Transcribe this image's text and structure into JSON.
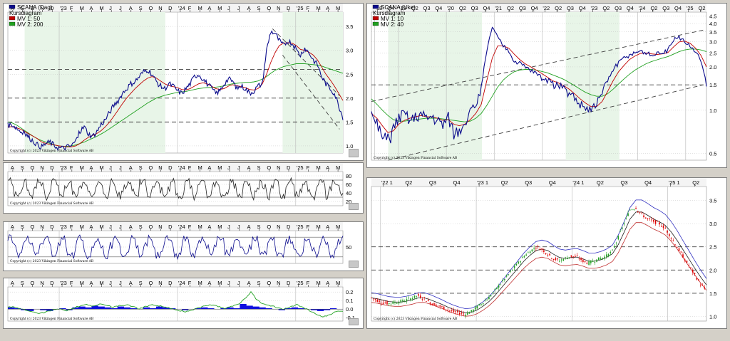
{
  "copyright": "Copyright (c) 2023 Vikingen Financial Software AB",
  "colors": {
    "price": "#0a0a8c",
    "ma1": "#c00000",
    "ma2": "#20a020",
    "up": "#20a020",
    "down": "#e00000",
    "grid": "#b8b8b8",
    "shade": "#e8f5e8",
    "dash": "#404040"
  },
  "chart_data": [
    {
      "type": "line",
      "legend": [
        {
          "label": "SCANA (Dag)",
          "swatch": "price"
        },
        {
          "label": "Kursdiagram"
        },
        {
          "label": "MV 1: 50",
          "swatch": "ma1"
        },
        {
          "label": "MV 2: 200",
          "swatch": "ma2"
        }
      ],
      "x_ticks": [
        "A",
        "S",
        "O",
        "N",
        "D",
        "'23",
        "F",
        "M",
        "A",
        "M",
        "J",
        "J",
        "A",
        "S",
        "O",
        "N",
        "D",
        "'24",
        "F",
        "M",
        "A",
        "M",
        "J",
        "J",
        "A",
        "S",
        "O",
        "N",
        "D",
        "'25",
        "F",
        "M",
        "A",
        "M"
      ],
      "y_ticks": [
        1.0,
        1.5,
        2.0,
        2.5,
        3.0,
        3.5
      ],
      "ylim": [
        0.85,
        3.8
      ],
      "series": [
        {
          "role": "price",
          "values": [
            1.43,
            1.45,
            1.38,
            1.3,
            1.25,
            1.18,
            1.1,
            1.02,
            0.98,
            1.05,
            1.08,
            1.0,
            0.96,
            0.95,
            0.98,
            1.0,
            1.1,
            1.3,
            1.4,
            1.25,
            1.2,
            1.3,
            1.45,
            1.55,
            1.7,
            1.85,
            1.95,
            2.1,
            2.2,
            2.3,
            2.35,
            2.45,
            2.55,
            2.6,
            2.5,
            2.35,
            2.25,
            2.2,
            2.3,
            2.25,
            2.15,
            2.1,
            2.2,
            2.3,
            2.45,
            2.5,
            2.4,
            2.3,
            2.2,
            2.1,
            2.15,
            2.3,
            2.4,
            2.35,
            2.2,
            2.25,
            2.2,
            2.1,
            2.15,
            2.25,
            2.3,
            3.0,
            3.4,
            3.35,
            3.2,
            3.1,
            3.2,
            3.15,
            3.0,
            2.9,
            3.05,
            2.95,
            2.8,
            2.7,
            2.45,
            2.3,
            2.2,
            2.1,
            1.85,
            1.6
          ]
        },
        {
          "role": "ma1",
          "values": [
            1.4,
            1.4,
            1.38,
            1.35,
            1.3,
            1.25,
            1.2,
            1.15,
            1.08,
            1.05,
            1.03,
            1.02,
            1.0,
            0.99,
            0.98,
            0.98,
            1.0,
            1.05,
            1.12,
            1.18,
            1.22,
            1.26,
            1.32,
            1.4,
            1.5,
            1.62,
            1.75,
            1.88,
            2.0,
            2.1,
            2.2,
            2.28,
            2.36,
            2.42,
            2.45,
            2.42,
            2.36,
            2.3,
            2.26,
            2.24,
            2.22,
            2.18,
            2.17,
            2.2,
            2.25,
            2.3,
            2.32,
            2.3,
            2.25,
            2.2,
            2.18,
            2.2,
            2.25,
            2.28,
            2.26,
            2.24,
            2.22,
            2.18,
            2.17,
            2.2,
            2.3,
            2.5,
            2.75,
            2.95,
            3.1,
            3.15,
            3.16,
            3.15,
            3.1,
            3.02,
            3.0,
            2.96,
            2.9,
            2.8,
            2.65,
            2.5,
            2.38,
            2.25,
            2.1,
            1.95
          ]
        },
        {
          "role": "ma2",
          "values": [
            1.5,
            1.48,
            1.44,
            1.38,
            1.32,
            1.26,
            1.2,
            1.15,
            1.11,
            1.08,
            1.05,
            1.02,
            1.0,
            0.99,
            0.99,
            1.0,
            1.02,
            1.05,
            1.08,
            1.12,
            1.16,
            1.2,
            1.25,
            1.3,
            1.36,
            1.42,
            1.48,
            1.54,
            1.6,
            1.66,
            1.72,
            1.78,
            1.84,
            1.9,
            1.95,
            2.0,
            2.03,
            2.06,
            2.08,
            2.1,
            2.12,
            2.13,
            2.14,
            2.16,
            2.18,
            2.2,
            2.21,
            2.22,
            2.22,
            2.23,
            2.24,
            2.26,
            2.28,
            2.3,
            2.31,
            2.32,
            2.33,
            2.33,
            2.34,
            2.36,
            2.4,
            2.45,
            2.52,
            2.58,
            2.62,
            2.66,
            2.68,
            2.7,
            2.72,
            2.72,
            2.72,
            2.71,
            2.7,
            2.69,
            2.67,
            2.64,
            2.61,
            2.58,
            2.55,
            2.52
          ]
        }
      ],
      "hlines": [
        1.5,
        2.0,
        2.6
      ],
      "trend": [
        [
          0.79,
          3.45,
          0.99,
          2.05
        ],
        [
          0.82,
          2.9,
          0.99,
          1.35
        ]
      ]
    },
    {
      "type": "line",
      "legend": [
        {
          "label": "SCANA (Uke)",
          "swatch": "price"
        },
        {
          "label": "Kursdiagram"
        },
        {
          "label": "MV 1: 10",
          "swatch": "ma1"
        },
        {
          "label": "MV 2: 40",
          "swatch": "ma2"
        }
      ],
      "x_ticks": [
        "'18",
        "Q4",
        "'19",
        "Q2",
        "Q3",
        "Q4",
        "'20",
        "Q2",
        "Q3",
        "Q4",
        "'21",
        "Q2",
        "Q3",
        "Q4",
        "'22",
        "Q2",
        "Q3",
        "Q4",
        "'23",
        "Q2",
        "Q3",
        "Q4",
        "'24",
        "Q2",
        "Q3",
        "Q4",
        "'25",
        "Q2"
      ],
      "y_ticks": [
        0.5,
        1.0,
        1.5,
        2.0,
        2.5,
        3.0,
        3.5,
        4.0,
        4.5
      ],
      "y_scale": "log",
      "ylim": [
        0.45,
        4.8
      ],
      "series": [
        {
          "role": "price",
          "values": [
            0.9,
            0.8,
            0.65,
            0.6,
            0.75,
            0.9,
            0.95,
            0.85,
            0.9,
            0.95,
            0.88,
            0.92,
            0.85,
            0.8,
            0.9,
            0.7,
            0.75,
            0.85,
            0.95,
            1.1,
            1.4,
            2.5,
            3.8,
            3.2,
            2.8,
            2.6,
            2.2,
            2.1,
            2.0,
            1.9,
            1.8,
            1.7,
            1.6,
            1.5,
            1.5,
            1.4,
            1.3,
            1.2,
            1.1,
            1.05,
            1.0,
            1.1,
            1.3,
            1.6,
            1.9,
            2.1,
            2.3,
            2.4,
            2.5,
            2.6,
            2.5,
            2.4,
            2.45,
            2.5,
            2.6,
            3.1,
            3.2,
            3.0,
            2.8,
            2.5,
            2.2,
            1.5
          ]
        },
        {
          "role": "ma1",
          "values": [
            0.95,
            0.88,
            0.78,
            0.7,
            0.72,
            0.8,
            0.85,
            0.88,
            0.9,
            0.92,
            0.9,
            0.9,
            0.88,
            0.85,
            0.86,
            0.8,
            0.78,
            0.8,
            0.86,
            0.95,
            1.1,
            1.6,
            2.3,
            2.8,
            2.8,
            2.7,
            2.45,
            2.25,
            2.1,
            2.0,
            1.9,
            1.8,
            1.7,
            1.6,
            1.55,
            1.48,
            1.4,
            1.3,
            1.2,
            1.12,
            1.06,
            1.06,
            1.15,
            1.35,
            1.6,
            1.85,
            2.05,
            2.25,
            2.38,
            2.48,
            2.5,
            2.46,
            2.44,
            2.46,
            2.52,
            2.75,
            2.98,
            3.02,
            2.92,
            2.7,
            2.4,
            2.0
          ]
        },
        {
          "role": "ma2",
          "values": [
            1.2,
            1.1,
            1.0,
            0.92,
            0.86,
            0.84,
            0.84,
            0.85,
            0.86,
            0.87,
            0.88,
            0.88,
            0.88,
            0.87,
            0.86,
            0.85,
            0.84,
            0.83,
            0.84,
            0.88,
            0.95,
            1.08,
            1.25,
            1.45,
            1.62,
            1.75,
            1.85,
            1.9,
            1.92,
            1.92,
            1.9,
            1.86,
            1.82,
            1.76,
            1.7,
            1.64,
            1.56,
            1.48,
            1.4,
            1.33,
            1.28,
            1.25,
            1.25,
            1.3,
            1.4,
            1.52,
            1.65,
            1.78,
            1.9,
            2.0,
            2.1,
            2.18,
            2.24,
            2.3,
            2.36,
            2.45,
            2.55,
            2.62,
            2.66,
            2.66,
            2.62,
            2.55
          ]
        }
      ],
      "hlines": [
        1.5
      ],
      "trend": [
        [
          0.0,
          1.15,
          0.99,
          3.6
        ],
        [
          0.05,
          0.45,
          0.99,
          1.5
        ]
      ]
    },
    {
      "type": "line",
      "x_ticks": [
        "A",
        "S",
        "O",
        "N",
        "D",
        "'23",
        "F",
        "M",
        "A",
        "M",
        "J",
        "J",
        "A",
        "S",
        "O",
        "N",
        "D",
        "'24",
        "F",
        "M",
        "A",
        "M",
        "J",
        "J",
        "A",
        "S",
        "O",
        "N",
        "D",
        "'25",
        "F",
        "M",
        "A",
        "M"
      ],
      "y_ticks": [
        20,
        40,
        60,
        80
      ],
      "ylim": [
        10,
        90
      ],
      "hlines": [
        30,
        70
      ],
      "waves": {
        "base": 50,
        "amp": 28,
        "points": 260
      }
    },
    {
      "type": "line",
      "x_ticks": [
        "A",
        "S",
        "O",
        "N",
        "D",
        "'23",
        "F",
        "M",
        "A",
        "M",
        "J",
        "J",
        "A",
        "S",
        "O",
        "N",
        "D",
        "'24",
        "F",
        "M",
        "A",
        "M",
        "J",
        "J",
        "A",
        "S",
        "O",
        "N",
        "D",
        "'25",
        "F",
        "M",
        "A",
        "M"
      ],
      "y_ticks": [
        50
      ],
      "ylim": [
        0,
        100
      ],
      "hlines": [
        20,
        80
      ],
      "waves": {
        "base": 50,
        "amp": 38,
        "points": 220
      }
    },
    {
      "type": "area",
      "x_ticks": [
        "A",
        "S",
        "O",
        "N",
        "D",
        "'23",
        "F",
        "M",
        "A",
        "M",
        "J",
        "J",
        "A",
        "S",
        "O",
        "N",
        "D",
        "'24",
        "F",
        "M",
        "A",
        "M",
        "J",
        "J",
        "A",
        "S",
        "O",
        "N",
        "D",
        "'25",
        "F",
        "M",
        "A",
        "M"
      ],
      "y_ticks": [
        -0.1,
        0.0,
        0.1,
        0.2
      ],
      "ylim": [
        -0.14,
        0.26
      ],
      "series": [
        {
          "role": "hist",
          "values": [
            0.02,
            0.01,
            -0.01,
            -0.02,
            0.0,
            -0.01,
            -0.02,
            0.0,
            0.01,
            -0.01,
            0.02,
            0.03,
            0.02,
            0.04,
            0.03,
            0.02,
            0.01,
            0.03,
            0.02,
            0.01,
            0.0,
            0.02,
            0.01,
            0.03,
            0.02,
            0.01,
            0.0,
            -0.01,
            0.0,
            0.01,
            0.02,
            0.01,
            0.0,
            0.01,
            0.02,
            0.01,
            0.06,
            0.04,
            0.03,
            0.02,
            0.01,
            0.0,
            -0.01,
            0.01,
            0.02,
            0.01,
            0.0,
            -0.01,
            -0.02,
            -0.01,
            0.01,
            0.0
          ]
        },
        {
          "role": "signal",
          "values": [
            0.03,
            0.02,
            0.0,
            -0.02,
            -0.04,
            -0.05,
            -0.03,
            -0.01,
            0.0,
            -0.02,
            0.01,
            0.04,
            0.05,
            0.03,
            0.06,
            0.05,
            0.02,
            0.04,
            0.05,
            0.03,
            0.0,
            0.03,
            0.05,
            0.04,
            0.02,
            0.0,
            -0.02,
            -0.03,
            -0.01,
            0.02,
            0.04,
            0.05,
            0.03,
            0.01,
            0.03,
            0.05,
            0.12,
            0.2,
            0.1,
            0.06,
            0.04,
            0.02,
            0.0,
            0.03,
            0.05,
            0.02,
            -0.02,
            -0.06,
            -0.09,
            -0.07,
            -0.03,
            -0.02
          ]
        }
      ]
    },
    {
      "type": "bar",
      "x_ticks": [
        "'22 1",
        "Q2",
        "Q3",
        "Q4",
        "'23 1",
        "Q2",
        "Q3",
        "Q4",
        "'24 1",
        "Q2",
        "Q3",
        "Q4",
        "'25 1",
        "Q2"
      ],
      "y_ticks": [
        1.0,
        1.5,
        2.0,
        2.5,
        3.0,
        3.5
      ],
      "ylim": [
        0.9,
        3.8
      ],
      "hlines": [
        1.5,
        2.0,
        2.5
      ],
      "series": [
        {
          "role": "candles",
          "values": [
            1.4,
            1.35,
            1.3,
            1.28,
            1.3,
            1.32,
            1.35,
            1.4,
            1.45,
            1.38,
            1.3,
            1.25,
            1.2,
            1.15,
            1.1,
            1.08,
            1.05,
            1.1,
            1.2,
            1.3,
            1.4,
            1.55,
            1.7,
            1.85,
            2.0,
            2.15,
            2.3,
            2.4,
            2.5,
            2.45,
            2.35,
            2.25,
            2.2,
            2.25,
            2.3,
            2.28,
            2.2,
            2.15,
            2.2,
            2.25,
            2.3,
            2.4,
            2.7,
            3.0,
            3.3,
            3.35,
            3.2,
            3.1,
            3.05,
            3.0,
            2.9,
            2.7,
            2.5,
            2.3,
            2.1,
            1.9,
            1.7,
            1.55
          ]
        },
        {
          "role": "band_mid",
          "values": [
            1.4,
            1.38,
            1.35,
            1.32,
            1.31,
            1.31,
            1.33,
            1.36,
            1.4,
            1.4,
            1.36,
            1.31,
            1.26,
            1.2,
            1.15,
            1.11,
            1.08,
            1.09,
            1.14,
            1.22,
            1.32,
            1.45,
            1.6,
            1.75,
            1.9,
            2.05,
            2.2,
            2.32,
            2.42,
            2.45,
            2.42,
            2.34,
            2.27,
            2.25,
            2.27,
            2.28,
            2.24,
            2.19,
            2.19,
            2.22,
            2.27,
            2.35,
            2.55,
            2.82,
            3.1,
            3.25,
            3.25,
            3.18,
            3.1,
            3.04,
            2.96,
            2.82,
            2.64,
            2.44,
            2.24,
            2.04,
            1.85,
            1.68
          ]
        }
      ]
    }
  ]
}
